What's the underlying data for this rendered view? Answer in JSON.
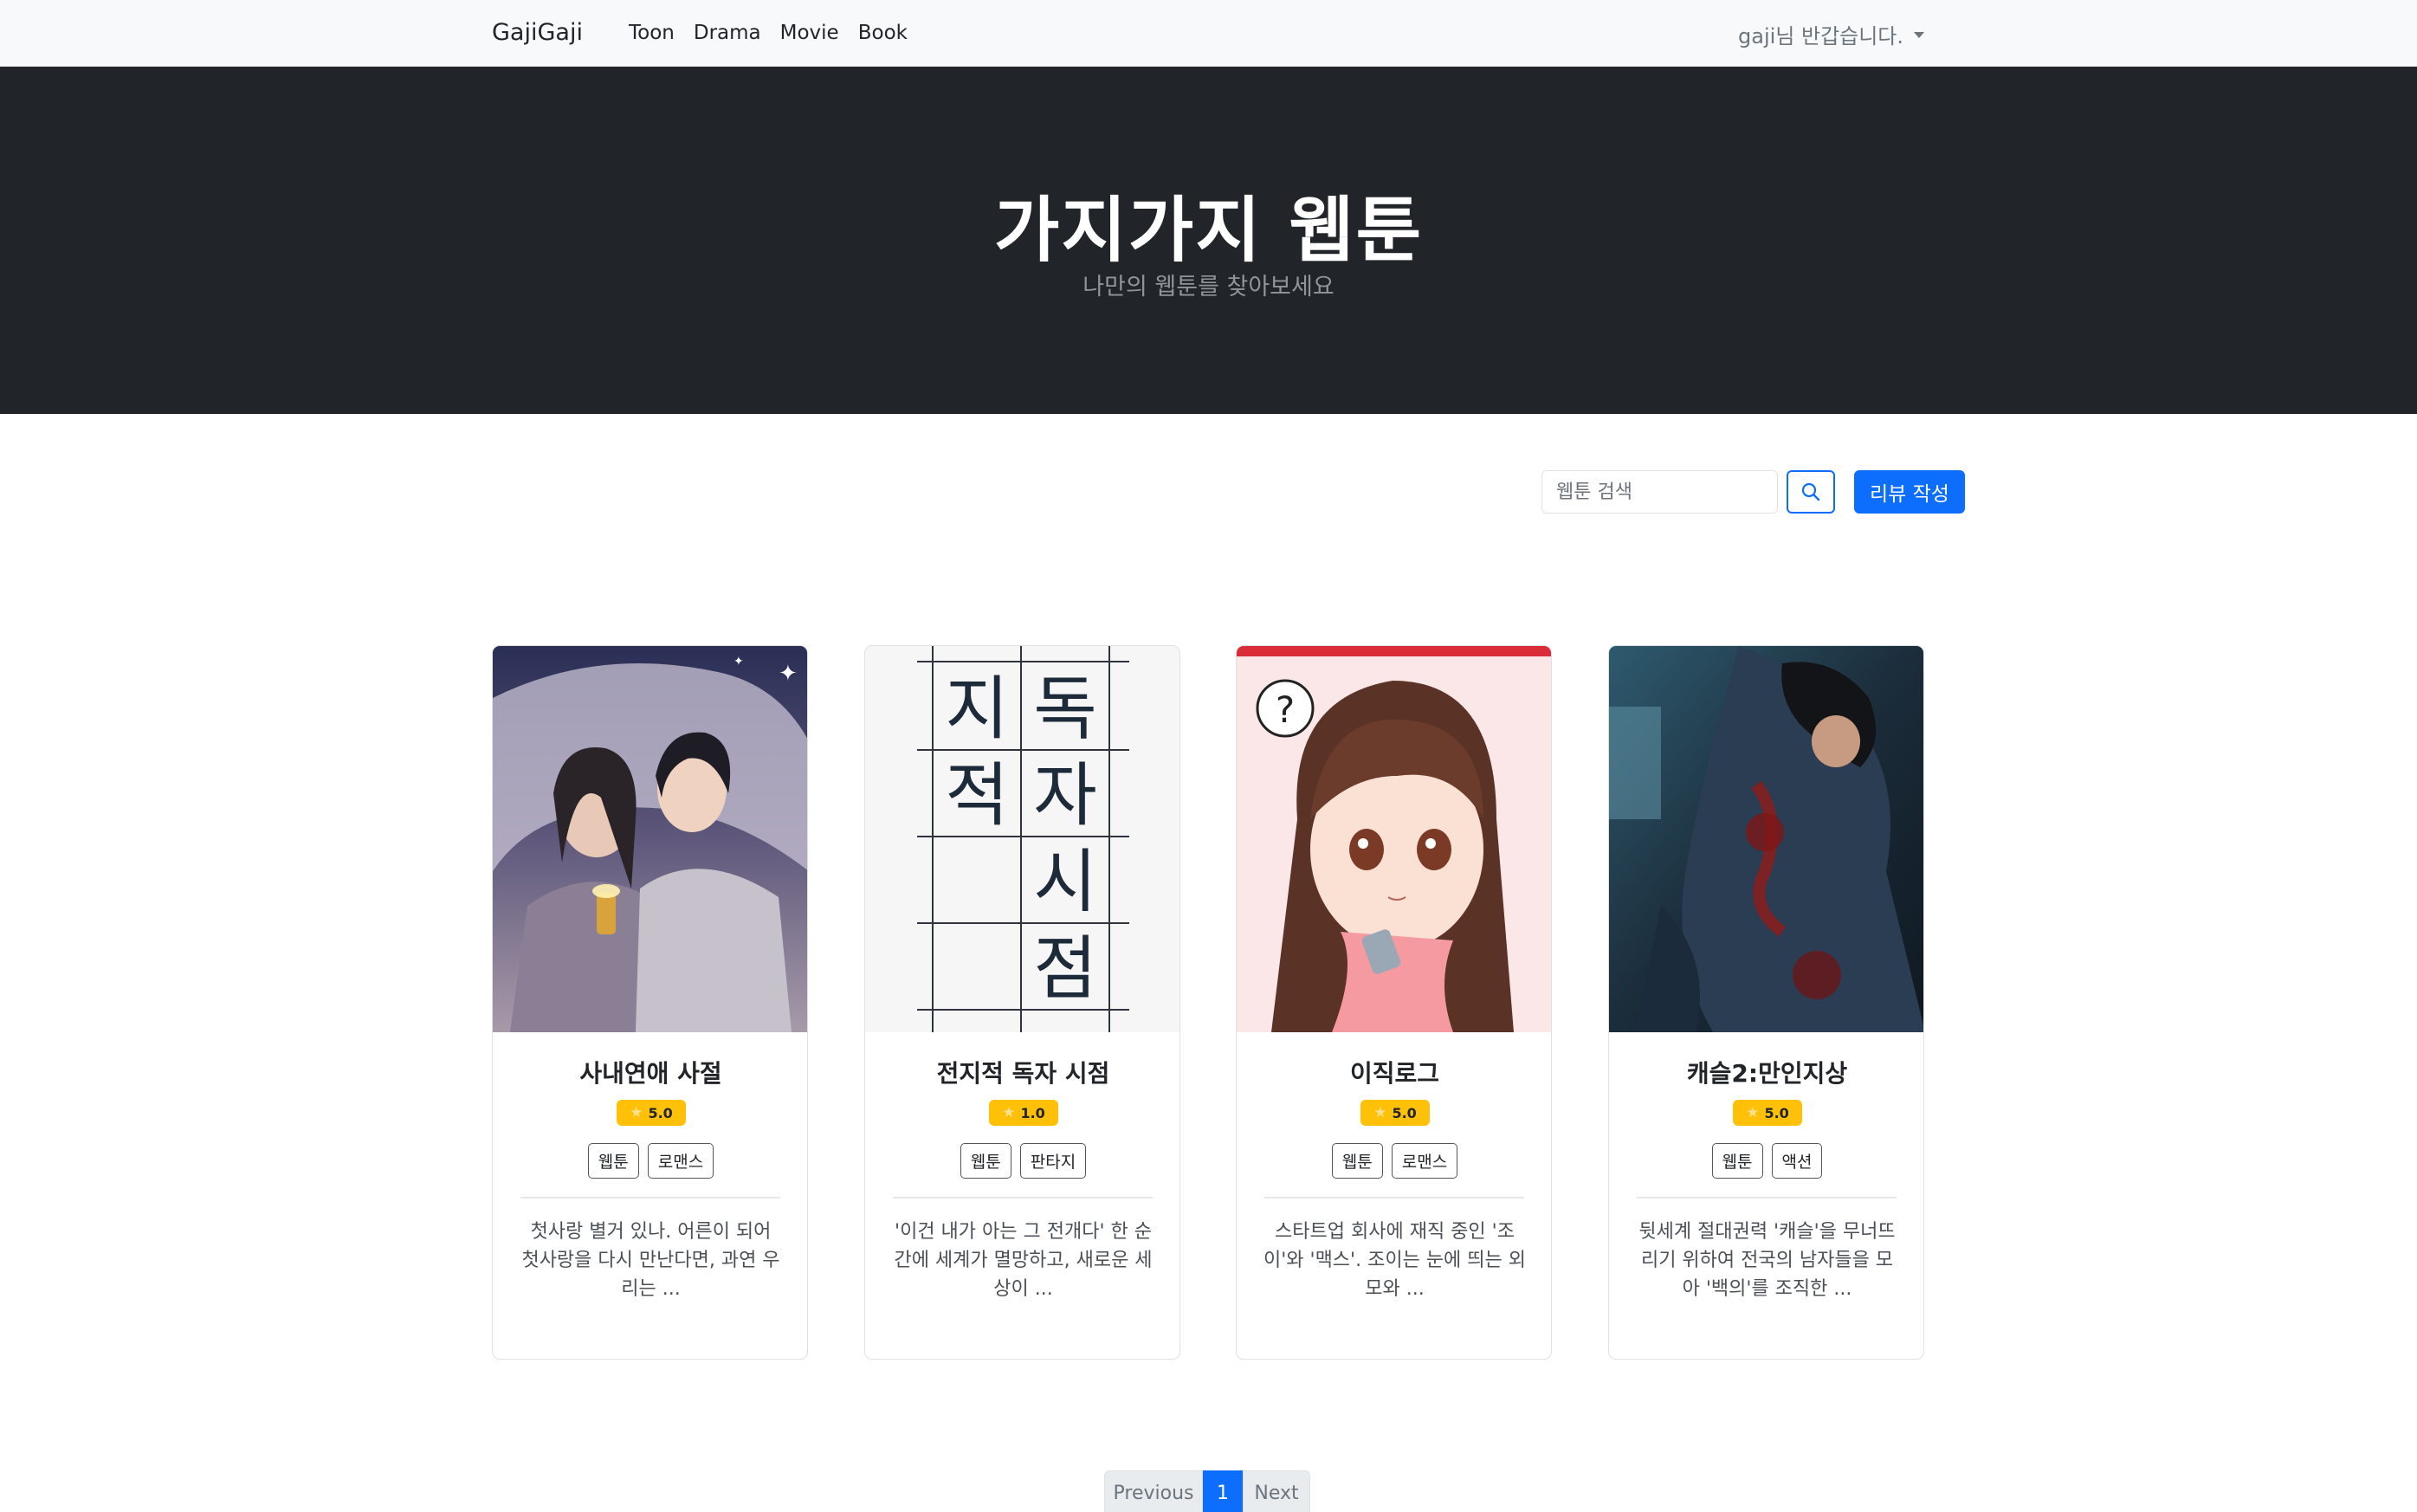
{
  "navbar": {
    "brand": "GajiGaji",
    "links": [
      "Toon",
      "Drama",
      "Movie",
      "Book"
    ],
    "user_greeting": "gaji님 반갑습니다."
  },
  "hero": {
    "title": "가지가지 웹툰",
    "subtitle": "나만의 웹툰를 찾아보세요"
  },
  "search": {
    "placeholder": "웹툰 검색",
    "button_icon": "search-icon",
    "write_button": "리뷰 작성"
  },
  "cards": [
    {
      "title": "사내연애 사절",
      "rating": "5.0",
      "tags": [
        "웹툰",
        "로맨스"
      ],
      "description": "첫사랑 별거 있나. 어른이 되어 첫사랑을 다시 만난다면, 과연 우리는 ..."
    },
    {
      "title": "전지적 독자 시점",
      "rating": "1.0",
      "tags": [
        "웹툰",
        "판타지"
      ],
      "description": "'이건 내가 아는 그 전개다' 한 순간에 세계가 멸망하고, 새로운 세상이 ...",
      "cover_text": [
        "지",
        "독",
        "적",
        "자",
        "시",
        "점"
      ]
    },
    {
      "title": "이직로그",
      "rating": "5.0",
      "tags": [
        "웹툰",
        "로맨스"
      ],
      "description": "스타트업 회사에 재직 중인 '조이'와 '맥스'. 조이는 눈에 띄는 외모와 ...",
      "cover_text": [
        "?"
      ]
    },
    {
      "title": "캐슬2:만인지상",
      "rating": "5.0",
      "tags": [
        "웹툰",
        "액션"
      ],
      "description": "뒷세계 절대권력 '캐슬'을 무너뜨리기 위하여 전국의 남자들을 모아 '백의'를 조직한 ..."
    }
  ],
  "pagination": {
    "previous": "Previous",
    "current": "1",
    "next": "Next"
  },
  "colors": {
    "primary": "#0d6efd",
    "hero_bg": "#212529",
    "rating_badge": "#ffc107"
  }
}
